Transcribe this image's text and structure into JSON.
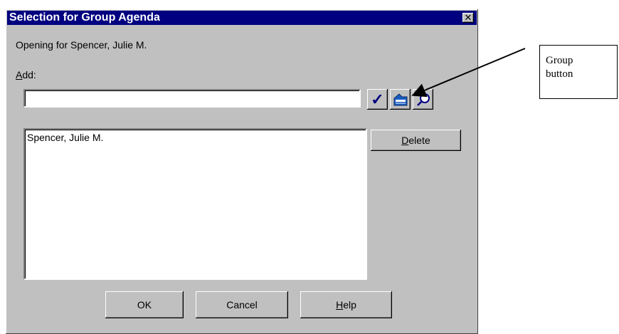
{
  "dialog": {
    "title": "Selection for Group Agenda",
    "opening_text": "Opening for Spencer, Julie M.",
    "add_label_mnemonic": "A",
    "add_label_rest": "dd:",
    "add_input_value": "",
    "list_items": [
      "Spencer, Julie M."
    ],
    "delete_mnemonic": "D",
    "delete_rest": "elete",
    "ok_label": "OK",
    "cancel_label": "Cancel",
    "help_mnemonic": "H",
    "help_rest": "elp",
    "close_glyph": "✕",
    "check_glyph": "✓",
    "icons": [
      "checkmark-icon",
      "group-icon",
      "magnifier-icon",
      "close-icon"
    ]
  },
  "annotation": {
    "callout_line1": "Group",
    "callout_line2": "button"
  },
  "colors": {
    "titlebar": "#000080",
    "dialog_face": "#c0c0c0",
    "check": "#000080",
    "group_icon": "#1a5bbf"
  }
}
